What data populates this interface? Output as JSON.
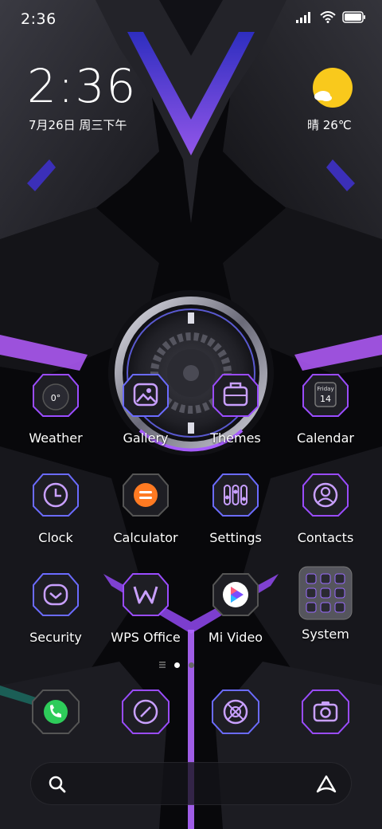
{
  "status_bar": {
    "time": "2:36",
    "icons": [
      "signal-icon",
      "wifi-icon",
      "battery-icon"
    ]
  },
  "clock_widget": {
    "time": "2:36",
    "date": "7月26日 周三下午"
  },
  "weather_widget": {
    "icon": "sun-cloud-icon",
    "text": "晴 26℃"
  },
  "apps": [
    {
      "name": "weather",
      "label": "Weather",
      "icon": "weather-icon",
      "glyph": "0°"
    },
    {
      "name": "gallery",
      "label": "Gallery",
      "icon": "gallery-icon"
    },
    {
      "name": "themes",
      "label": "Themes",
      "icon": "themes-icon"
    },
    {
      "name": "calendar",
      "label": "Calendar",
      "icon": "calendar-icon",
      "day": "Friday",
      "date": "14"
    },
    {
      "name": "clock",
      "label": "Clock",
      "icon": "clock-icon"
    },
    {
      "name": "calculator",
      "label": "Calculator",
      "icon": "calculator-icon"
    },
    {
      "name": "settings",
      "label": "Settings",
      "icon": "settings-icon"
    },
    {
      "name": "contacts",
      "label": "Contacts",
      "icon": "contacts-icon"
    },
    {
      "name": "security",
      "label": "Security",
      "icon": "security-icon"
    },
    {
      "name": "wps-office",
      "label": "WPS Office",
      "icon": "wps-icon"
    },
    {
      "name": "mi-video",
      "label": "Mi Video",
      "icon": "mi-video-icon"
    },
    {
      "name": "system",
      "label": "System",
      "icon": "folder-icon"
    }
  ],
  "dock": [
    {
      "name": "phone",
      "icon": "phone-icon"
    },
    {
      "name": "messages",
      "icon": "messages-icon"
    },
    {
      "name": "browser",
      "icon": "browser-icon"
    },
    {
      "name": "camera",
      "icon": "camera-icon"
    }
  ],
  "page_indicator": {
    "pages": 2,
    "current": 1
  },
  "search_bar": {
    "left_icon": "search-icon",
    "right_icon": "assistant-icon"
  },
  "colors": {
    "accent_purple": "#a65cff",
    "accent_blue": "#4f4ad8",
    "background": "#07070a",
    "weather_sun": "#f9c91c",
    "calculator": "#ff7a22",
    "phone": "#2ecc5a"
  }
}
